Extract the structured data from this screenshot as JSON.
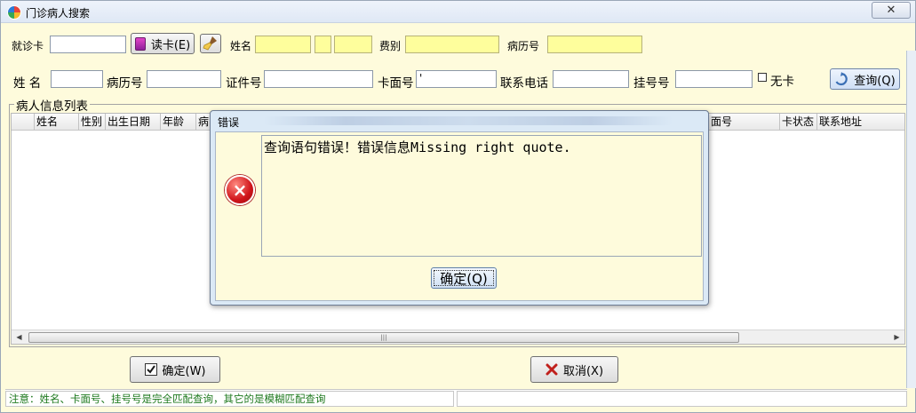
{
  "window": {
    "title": "门诊病人搜索",
    "close_icon": "✕"
  },
  "row1": {
    "card_label": "就诊卡",
    "card_value": "",
    "read_card_button": "读卡(E)",
    "name_label": "姓名",
    "fee_label": "费别",
    "record_label": "病历号"
  },
  "row2": {
    "name_label": "姓 名",
    "record_label": "病历号",
    "id_label": "证件号",
    "card_face_label": "卡面号",
    "card_face_value": "'",
    "phone_label": "联系电话",
    "reg_label": "挂号号",
    "no_card_label": "无卡",
    "search_button": "查询(Q)"
  },
  "patient_list": {
    "group_title": "病人信息列表",
    "columns_left": [
      "姓名",
      "性别",
      "出生日期",
      "年龄",
      "病"
    ],
    "columns_right": [
      "面号",
      "卡状态",
      "联系地址"
    ]
  },
  "buttons": {
    "confirm": "确定(W)",
    "cancel": "取消(X)"
  },
  "status": {
    "note": "注意：姓名、卡面号、挂号号是完全匹配查询，其它的是模糊匹配查询"
  },
  "dialog": {
    "title": "错误",
    "message": "查询语句错误！错误信息Missing right quote.",
    "ok_button": "确定(Q)",
    "error_icon": "×"
  },
  "colors": {
    "window_bg": "#fefbdc",
    "required_field": "#fefe9c",
    "dialog_bg": "#dbe9f6",
    "status_text": "#1f7a1f"
  }
}
